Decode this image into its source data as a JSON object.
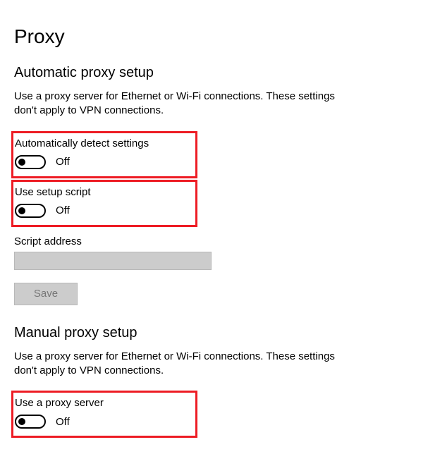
{
  "page": {
    "title": "Proxy"
  },
  "auto": {
    "section_title": "Automatic proxy setup",
    "description": "Use a proxy server for Ethernet or Wi-Fi connections. These settings don't apply to VPN connections.",
    "detect": {
      "label": "Automatically detect settings",
      "state": "Off"
    },
    "script": {
      "label": "Use setup script",
      "state": "Off"
    },
    "script_address_label": "Script address",
    "script_address_value": "",
    "save_label": "Save"
  },
  "manual": {
    "section_title": "Manual proxy setup",
    "description": "Use a proxy server for Ethernet or Wi-Fi connections. These settings don't apply to VPN connections.",
    "use_proxy": {
      "label": "Use a proxy server",
      "state": "Off"
    }
  }
}
